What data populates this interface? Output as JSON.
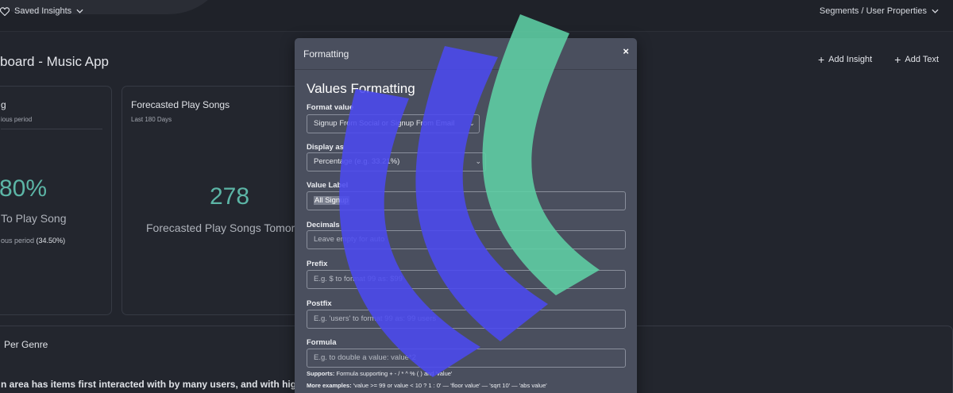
{
  "topbar": {
    "saved_label": "Saved Insights",
    "segments_label": "Segments / User Properties"
  },
  "dashboard": {
    "title": "board - Music App",
    "actions": {
      "add_insight": "Add Insight",
      "add_text": "Add Text"
    }
  },
  "cards": [
    {
      "title": "g",
      "subtitle": "ious period",
      "value": "80%",
      "label": "To Play Song",
      "prev_text": "ous period",
      "prev_value": "(34.50%)"
    },
    {
      "title": "Forecasted Play Songs",
      "subtitle": "Last 180 Days",
      "value": "278",
      "label": "Forecasted Play Songs Tomor"
    }
  ],
  "genre_card": {
    "title": "Per Genre",
    "text": "n area has items first interacted with by many users, and with hig"
  },
  "modal": {
    "header": "Formatting",
    "close": "×",
    "heading": "Values Formatting",
    "fields": {
      "format_value": {
        "label": "Format value",
        "value": "Signup From Social or Signup From Email"
      },
      "display_as": {
        "label": "Display as",
        "value": "Percentage (e.g. 33.21%)"
      },
      "value_label": {
        "label": "Value Label",
        "value": "All Signup"
      },
      "decimals": {
        "label": "Decimals",
        "placeholder": "Leave empty for auto"
      },
      "prefix": {
        "label": "Prefix",
        "placeholder": "E.g. $ to format 99 as: $99"
      },
      "postfix": {
        "label": "Postfix",
        "placeholder": "E.g. 'users' to format 99 as: 99 users"
      },
      "formula": {
        "label": "Formula",
        "placeholder": "E.g. to double a value: value*2"
      }
    },
    "supports_label": "Supports:",
    "supports_text": "Formula supporting + - / * ^ % ( ) and 'value'",
    "examples_label": "More examples:",
    "examples_text": "'value >= 99 or value < 10 ? 1 : 0' — 'floor value' — 'sqrt 10' — 'abs value'"
  },
  "colors": {
    "accent_teal": "#5cb5a6",
    "band_blue": "#4b4af0",
    "band_green": "#5fd0a5",
    "modal_bg": "#4a4f5e",
    "page_bg": "#22252d"
  }
}
